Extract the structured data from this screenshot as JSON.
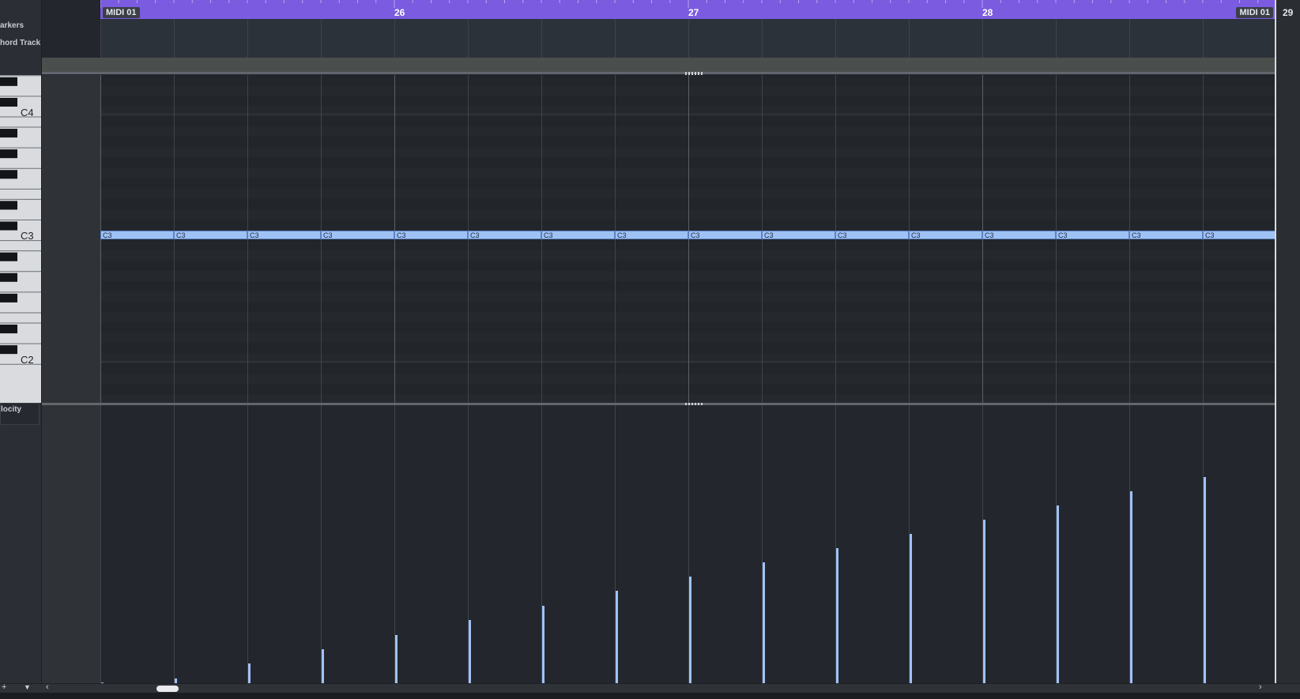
{
  "track_list": {
    "markers_label": "arkers",
    "chord_track_label": "hord Track",
    "velocity_label": "locity"
  },
  "ruler": {
    "bars": [
      "26",
      "27",
      "28"
    ],
    "next_bar": "29",
    "part_start_label": "MIDI 01",
    "part_end_label": "MIDI 01"
  },
  "keyboard": {
    "octave_labels": [
      "C4",
      "C3",
      "C2"
    ]
  },
  "notes": {
    "pitch_label": "C3",
    "count": 16,
    "velocities": [
      1,
      6,
      25,
      43,
      61,
      80,
      98,
      117,
      135,
      153,
      171,
      189,
      207,
      225,
      243,
      261
    ]
  },
  "colors": {
    "ruler": "#7b5be0",
    "note": "#9fc2f6",
    "velocity_bar": "#9fc2f6"
  },
  "icons": [
    "scroll-left-icon",
    "scroll-right-icon",
    "add-lane-icon",
    "lane-menu-icon"
  ]
}
